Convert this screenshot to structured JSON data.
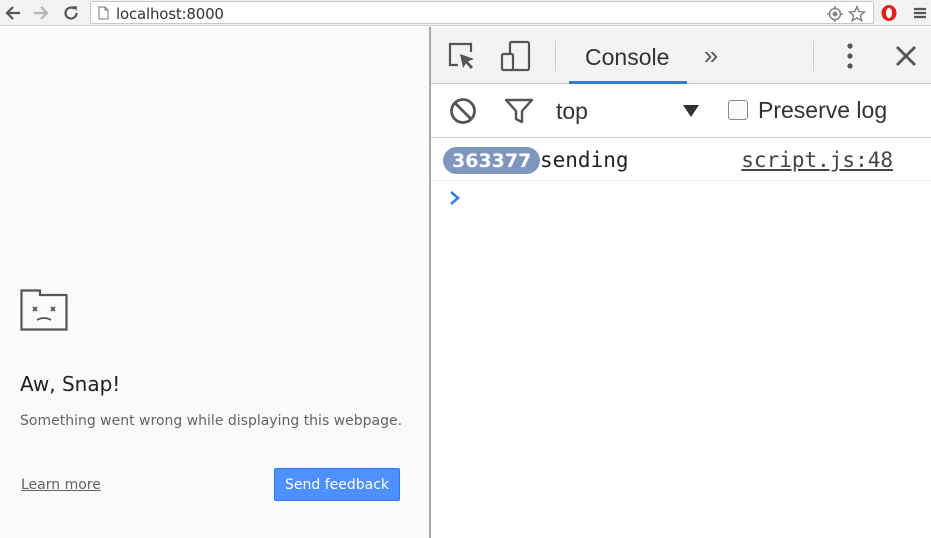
{
  "browser": {
    "url": "localhost:8000",
    "icons": [
      "back-arrow-icon",
      "forward-arrow-icon",
      "reload-icon",
      "page-icon",
      "location-icon",
      "star-icon",
      "opera-icon",
      "menu-icon"
    ]
  },
  "crash_page": {
    "title": "Aw, Snap!",
    "message": "Something went wrong while displaying this webpage.",
    "learn_more": "Learn more",
    "send_feedback": "Send feedback",
    "button_color": "#4d90fe"
  },
  "devtools": {
    "active_tab": "Console",
    "more_tabs": "»",
    "context": "top",
    "preserve_log": "Preserve log",
    "preserve_log_checked": false,
    "accent": "#3879d9",
    "messages": [
      {
        "count": "363377",
        "text": "sending",
        "source": "script.js:48"
      }
    ]
  }
}
